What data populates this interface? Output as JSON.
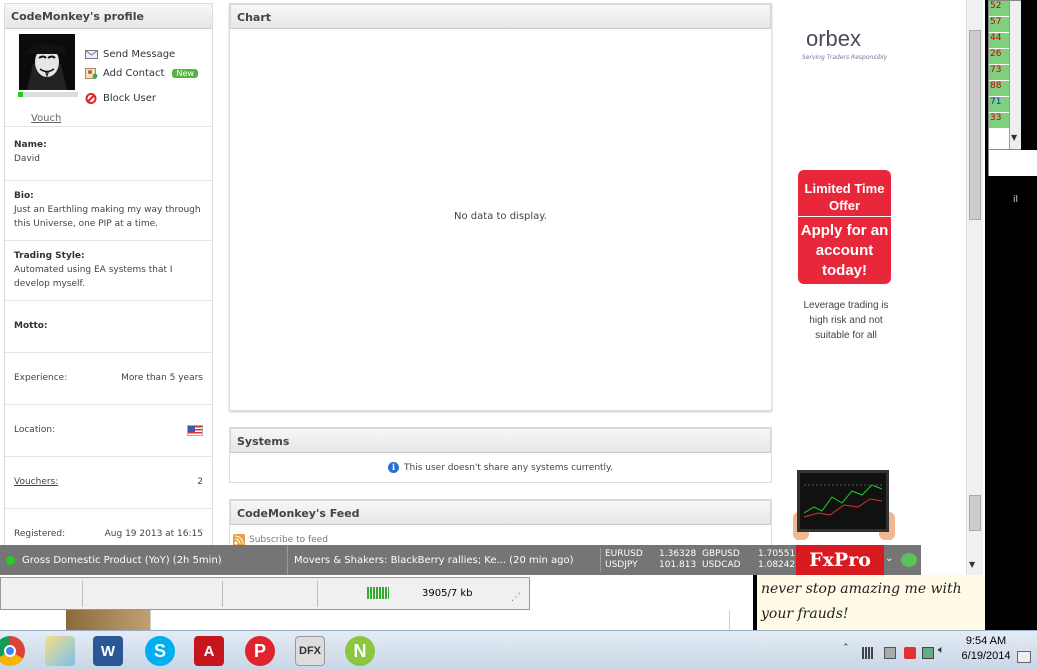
{
  "profile": {
    "title": "CodeMonkey's profile",
    "vouch": "Vouch",
    "actions": {
      "send_message": "Send Message",
      "add_contact": "Add Contact",
      "new_badge": "New",
      "block_user": "Block User"
    },
    "name_label": "Name:",
    "name_value": "David",
    "bio_label": "Bio:",
    "bio_value": "Just an Earthling making my way through this Universe, one PIP at a time.",
    "style_label": "Trading Style:",
    "style_value": "Automated using EA systems that I develop myself.",
    "motto_label": "Motto:",
    "experience_label": "Experience:",
    "experience_value": "More than 5 years",
    "location_label": "Location:",
    "vouchers_label": "Vouchers:",
    "vouchers_value": "2",
    "registered_label": "Registered:",
    "registered_value": "Aug 19 2013 at 16:15"
  },
  "chart": {
    "title": "Chart",
    "empty": "No data to display."
  },
  "systems": {
    "title": "Systems",
    "message": "This user doesn't share any systems currently."
  },
  "feed": {
    "title": "CodeMonkey's Feed",
    "subscribe": "Subscribe to feed"
  },
  "ads": {
    "orbex_logo": "orbex",
    "orbex_tagline": "Serving Traders Responsibly",
    "offer_line1": "Limited Time Offer",
    "offer_line2": "Apply for an account today!",
    "risk": "Leverage trading is high risk and not suitable for all"
  },
  "ticker": {
    "event": "Gross Domestic Product (YoY) (2h 5min)",
    "news": "Movers & Shakers: BlackBerry rallies; Ke...  (20 min ago)",
    "rates": [
      {
        "pair": "EURUSD",
        "value": "1.36328"
      },
      {
        "pair": "GBPUSD",
        "value": "1.70551"
      },
      {
        "pair": "USDJPY",
        "value": "101.813"
      },
      {
        "pair": "USDCAD",
        "value": "1.08242"
      }
    ],
    "brand": "FxPro"
  },
  "side_list": [
    "52",
    "57",
    "44",
    "26",
    "73",
    "88",
    "71",
    "33"
  ],
  "side_text": "il",
  "statusbar": {
    "size": "3905/7 kb"
  },
  "meme": {
    "line1": "never stop amazing me with",
    "line2": "your frauds!"
  },
  "taskbar": {
    "apps": [
      "chrome-icon",
      "explorer-icon",
      "word-icon",
      "skype-icon",
      "acrobat-icon",
      "pinterest-icon",
      "dfx-icon",
      "ninja-icon"
    ],
    "dfx_label": "DFX",
    "time": "9:54 AM",
    "date": "6/19/2014"
  },
  "colors": {
    "ticker_bg": "#757575",
    "offer_red": "#e8283a",
    "fxpro_red": "#d71920",
    "online_green": "#29c929"
  }
}
